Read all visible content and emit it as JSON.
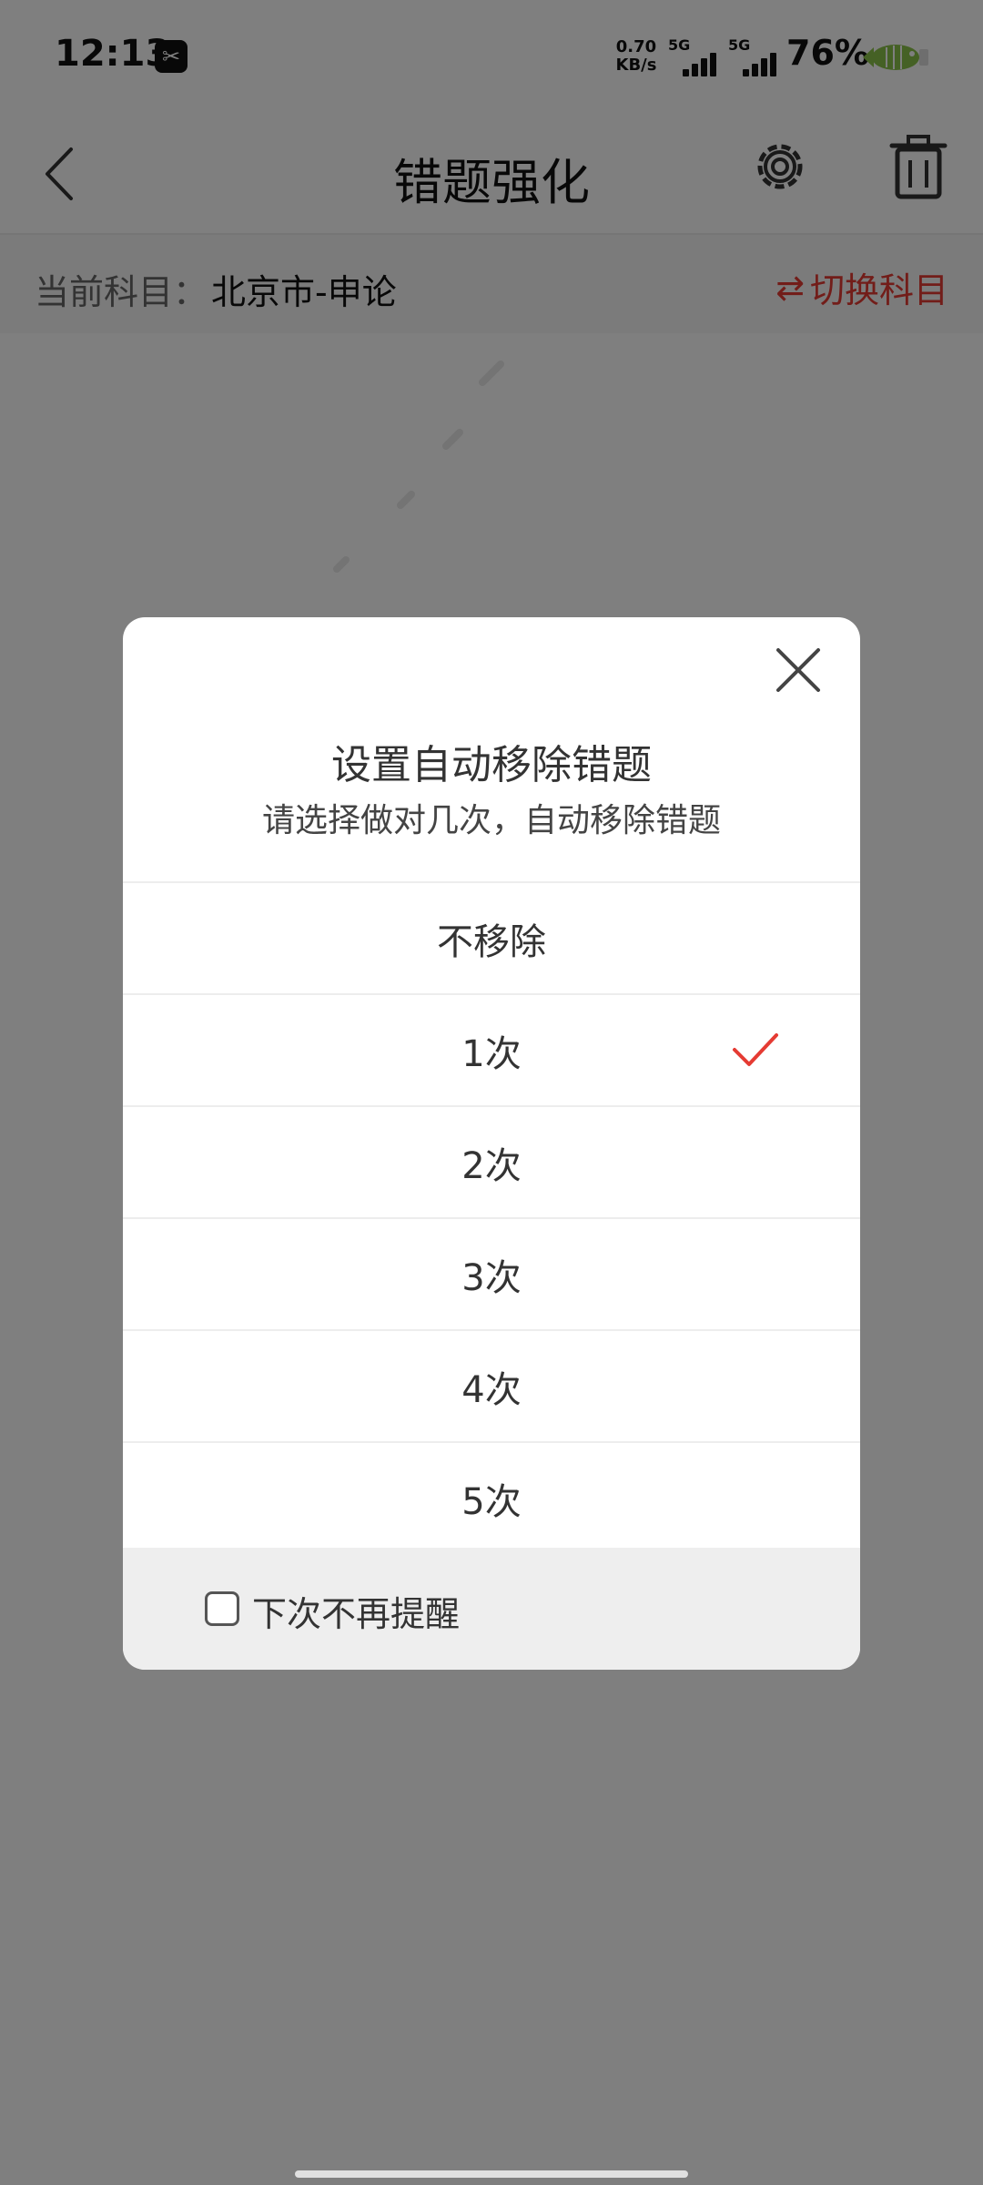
{
  "status_bar": {
    "time": "12:13",
    "net_speed_value": "0.70",
    "net_speed_unit": "KB/s",
    "signal1_label": "5G",
    "signal2_label": "5G",
    "battery": "76%"
  },
  "header": {
    "title": "错题强化"
  },
  "subject": {
    "label": "当前科目：",
    "value": "北京市-申论",
    "switch_label": "切换科目",
    "switch_icon": "⇄"
  },
  "dialog": {
    "title": "设置自动移除错题",
    "subtitle": "请选择做对几次，自动移除错题",
    "options": [
      {
        "label": "不移除",
        "selected": false
      },
      {
        "label": "1次",
        "selected": true
      },
      {
        "label": "2次",
        "selected": false
      },
      {
        "label": "3次",
        "selected": false
      },
      {
        "label": "4次",
        "selected": false
      },
      {
        "label": "5次",
        "selected": false
      }
    ],
    "dont_remind_label": "下次不再提醒",
    "dont_remind_checked": false
  },
  "colors": {
    "accent": "#e53b33",
    "overlay": "rgba(0,0,0,0.5)"
  }
}
